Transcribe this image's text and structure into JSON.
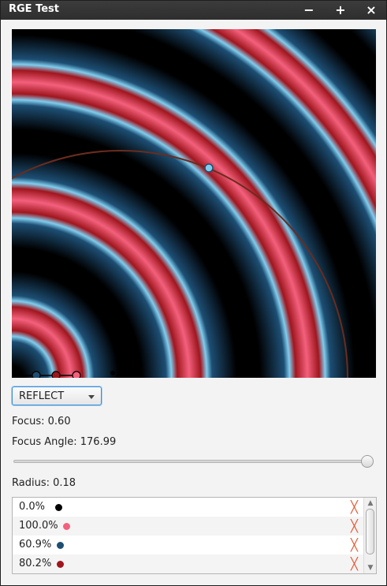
{
  "window": {
    "title": "RGE Test",
    "buttons": {
      "minimize": "−",
      "maximize": "+",
      "close": "×"
    }
  },
  "gradient": {
    "cycle_method": "REFLECT",
    "colors": {
      "black": "#000000",
      "pink": "#f3607c",
      "blue": "#1d4e73",
      "red": "#a0161e",
      "light_blue": "#7fcdee",
      "circle": "#6a2c1e"
    }
  },
  "controls": {
    "focus_label": "Focus: 0.60",
    "focus_angle_label": "Focus Angle: 176.99",
    "radius_label": "Radius: 0.18",
    "slider_value": 1.0
  },
  "stops": [
    {
      "percent": "0.0%",
      "color": "#000000",
      "delete": "╳"
    },
    {
      "percent": "100.0%",
      "color": "#f3607c",
      "delete": "╳"
    },
    {
      "percent": "60.9%",
      "color": "#1d4e73",
      "delete": "╳"
    },
    {
      "percent": "80.2%",
      "color": "#a0161e",
      "delete": "╳"
    }
  ],
  "scrollbar": {
    "up": "▲",
    "down": "▼"
  }
}
